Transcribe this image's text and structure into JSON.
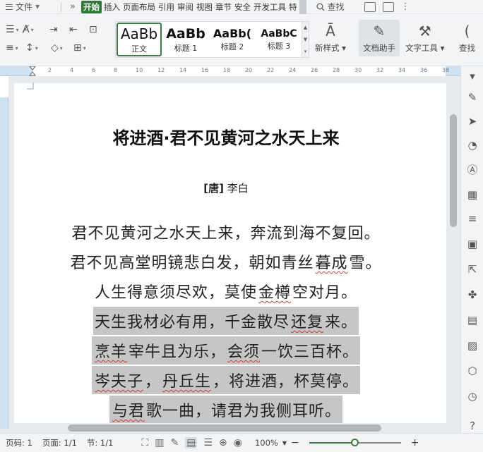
{
  "menubar": {
    "file_label": "文件",
    "more_label": "»",
    "tabs": [
      {
        "label": "开始",
        "active": true
      },
      {
        "label": "插入"
      },
      {
        "label": "页面布局"
      },
      {
        "label": "引用"
      },
      {
        "label": "审阅"
      },
      {
        "label": "视图"
      },
      {
        "label": "章节"
      },
      {
        "label": "安全"
      },
      {
        "label": "开发工具"
      },
      {
        "label": "特"
      }
    ],
    "search_label": "查找"
  },
  "ribbon": {
    "styles": [
      {
        "sample": "AaBb",
        "label": "正文",
        "selected": true
      },
      {
        "sample": "AaBb",
        "label": "标题 1"
      },
      {
        "sample": "AaBb(",
        "label": "标题 2"
      },
      {
        "sample": "AaBbC",
        "label": "标题 3"
      }
    ],
    "new_style_label": "新样式",
    "doc_assistant_label": "文档助手",
    "text_tools_label": "文字工具",
    "find_label": "查找"
  },
  "ruler_ticks": [
    "2",
    "4",
    "6",
    "8",
    "10",
    "12",
    "14",
    "16",
    "18",
    "20",
    "22",
    "24",
    "26",
    "28",
    "30",
    "32",
    "34",
    "36",
    "38"
  ],
  "document": {
    "title": "将进酒·君不见黄河之水天上来",
    "dynasty": "[唐]",
    "author": "李白",
    "lines": [
      {
        "text": "君不见黄河之水天上来，奔流到海不复回。",
        "highlight": false
      },
      {
        "text": "君不见高堂明镜悲白发，朝如青丝暮成雪。",
        "highlight": false
      },
      {
        "text": "人生得意须尽欢，莫使金樽空对月。",
        "highlight": false
      },
      {
        "text": "天生我材必有用，千金散尽还复来。",
        "highlight": true
      },
      {
        "text": "烹羊宰牛且为乐，会须一饮三百杯。",
        "highlight": true
      },
      {
        "text": "岑夫子，丹丘生，将进酒，杯莫停。",
        "highlight": true
      },
      {
        "text": "与君歌一曲，请君为我侧耳听。",
        "highlight": true
      }
    ]
  },
  "statusbar": {
    "page_code": "页码: 1",
    "page": "页面: 1/1",
    "section": "节: 1/1",
    "zoom": "100%",
    "zoom_level": 0.5
  },
  "colors": {
    "accent": "#2f7a39",
    "highlight": "#c6c6c6",
    "ruler": "#cfe2f3"
  }
}
